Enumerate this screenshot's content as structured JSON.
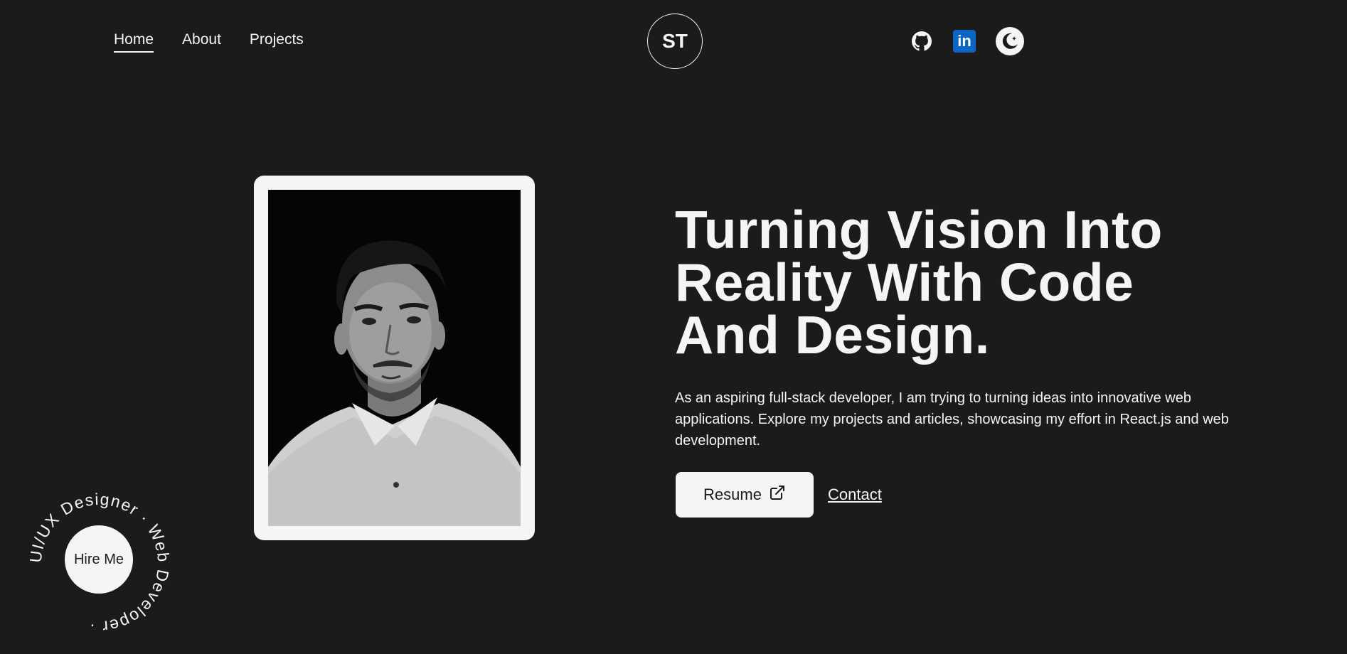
{
  "nav": {
    "items": [
      {
        "label": "Home",
        "active": true
      },
      {
        "label": "About",
        "active": false
      },
      {
        "label": "Projects",
        "active": false
      }
    ]
  },
  "logo": {
    "initials": "ST"
  },
  "header_icons": [
    "github-icon",
    "linkedin-icon",
    "theme-toggle-moon-icon"
  ],
  "linkedin": {
    "glyph": "in"
  },
  "hero": {
    "headline": "Turning Vision Into Reality With Code And Design.",
    "description": "As an aspiring full-stack developer, I am trying to turning ideas into innovative web applications. Explore my projects and articles, showcasing my effort in React.js and web development.",
    "resume_label": "Resume",
    "contact_label": "Contact"
  },
  "badge": {
    "center_label": "Hire Me",
    "ring_text": "UI/UX Designer · Web Developer ·"
  },
  "colors": {
    "background": "#1b1b1b",
    "foreground": "#f5f5f5",
    "linkedin": "#0a66c2"
  }
}
